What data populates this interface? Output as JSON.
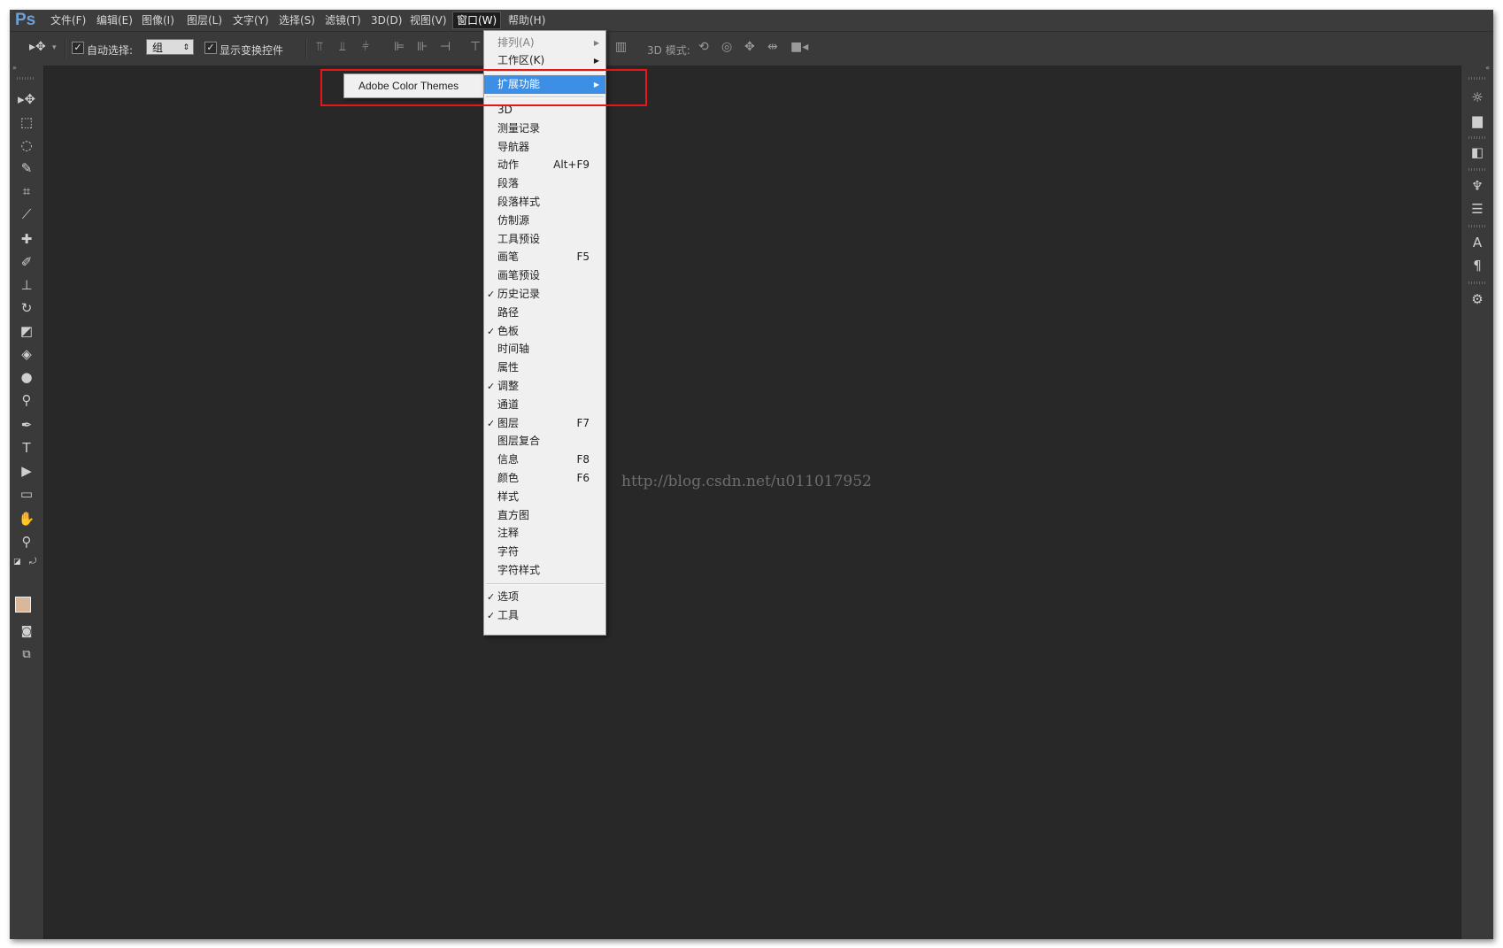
{
  "app": {
    "logo": "Ps"
  },
  "menubar": {
    "items": [
      "文件(F)",
      "编辑(E)",
      "图像(I)",
      "图层(L)",
      "文字(Y)",
      "选择(S)",
      "滤镜(T)",
      "3D(D)",
      "视图(V)",
      "窗口(W)",
      "帮助(H)"
    ],
    "active": "窗口(W)"
  },
  "options": {
    "auto_select_label": "自动选择:",
    "auto_select_value": "组",
    "show_transform_label": "显示变换控件",
    "mode_3d_label": "3D 模式:"
  },
  "window_menu": {
    "top_items": [
      {
        "label": "排列(A)",
        "arrow": true,
        "disabled": true
      },
      {
        "label": "工作区(K)",
        "arrow": true
      }
    ],
    "extensions": {
      "label": "扩展功能",
      "arrow": true
    },
    "panels": [
      {
        "label": "3D"
      },
      {
        "label": "测量记录"
      },
      {
        "label": "导航器"
      },
      {
        "label": "动作",
        "shortcut": "Alt+F9"
      },
      {
        "label": "段落"
      },
      {
        "label": "段落样式"
      },
      {
        "label": "仿制源"
      },
      {
        "label": "工具预设"
      },
      {
        "label": "画笔",
        "shortcut": "F5"
      },
      {
        "label": "画笔预设"
      },
      {
        "label": "历史记录",
        "checked": true
      },
      {
        "label": "路径"
      },
      {
        "label": "色板",
        "checked": true
      },
      {
        "label": "时间轴"
      },
      {
        "label": "属性"
      },
      {
        "label": "调整",
        "checked": true
      },
      {
        "label": "通道"
      },
      {
        "label": "图层",
        "checked": true,
        "shortcut": "F7"
      },
      {
        "label": "图层复合"
      },
      {
        "label": "信息",
        "shortcut": "F8"
      },
      {
        "label": "颜色",
        "shortcut": "F6"
      },
      {
        "label": "样式"
      },
      {
        "label": "直方图"
      },
      {
        "label": "注释"
      },
      {
        "label": "字符"
      },
      {
        "label": "字符样式"
      }
    ],
    "bottom_items": [
      {
        "label": "选项",
        "checked": true
      },
      {
        "label": "工具",
        "checked": true
      }
    ]
  },
  "extensions_submenu": {
    "items": [
      "Adobe Color Themes"
    ]
  },
  "watermark": "http://blog.csdn.net/u011017952",
  "colors": {
    "highlight": "#3d8ee5",
    "annotation_box": "#e8161b",
    "foreground_swatch": "#d8b79a",
    "background_swatch": "#ffffff"
  },
  "icons": {
    "toolbox": [
      "move-icon",
      "marquee-icon",
      "lasso-icon",
      "quick-select-icon",
      "crop-icon",
      "eyedropper-icon",
      "healing-brush-icon",
      "brush-icon",
      "clone-stamp-icon",
      "history-brush-icon",
      "eraser-icon",
      "paint-bucket-icon",
      "blur-icon",
      "dodge-icon",
      "pen-icon",
      "type-icon",
      "path-select-icon",
      "shape-icon",
      "hand-icon",
      "zoom-icon"
    ],
    "right_panel": [
      "sun-icon",
      "histogram-icon",
      "layers-icon",
      "adjust-icon",
      "sliders-icon",
      "character-icon",
      "paragraph-icon",
      "settings-icon"
    ]
  }
}
